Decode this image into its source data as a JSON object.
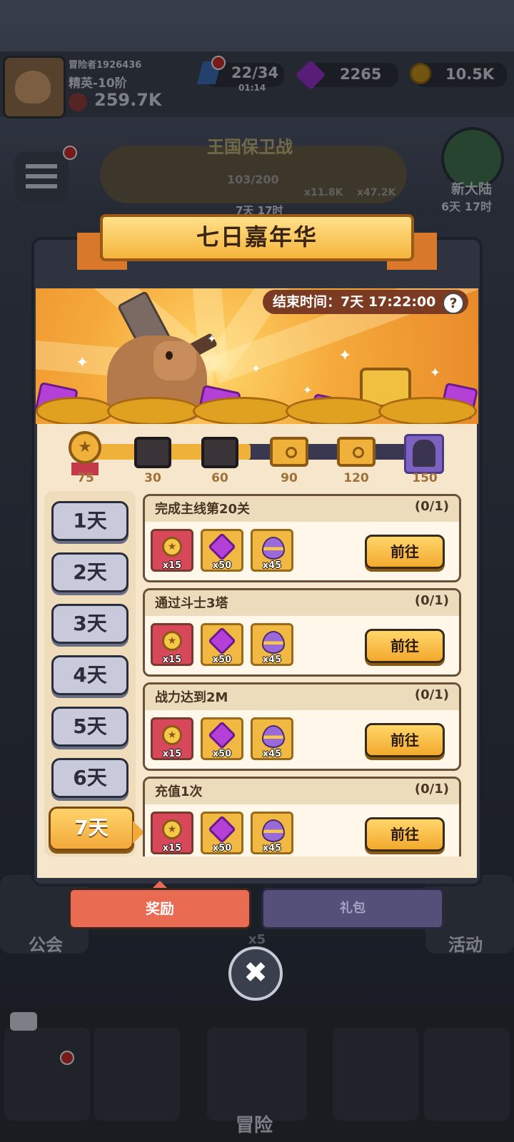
{
  "status_bar": {
    "player_name": "冒险者1926436",
    "rank": "精英-10阶",
    "power": "259.7K",
    "stamina": "22/34",
    "stamina_timer": "01:14",
    "gems": "2265",
    "coins": "10.5K"
  },
  "background_event": {
    "title": "王国保卫战",
    "progress": "103/200",
    "reward_a": "x11.8K",
    "reward_b": "x47.2K",
    "timer": "7天 17时"
  },
  "side_right": {
    "new_continent_label": "新大陆",
    "new_continent_timer": "6天 17时",
    "activity_label": "活动"
  },
  "side_left": {
    "guild_label": "公会"
  },
  "bottom_nav": {
    "adventure_label": "冒险",
    "multiplier": "x5"
  },
  "dialog": {
    "title": "七日嘉年华",
    "end_time": "结束时间：7天 17:22:00",
    "help_icon": "?",
    "milestones": [
      {
        "label": "75",
        "type": "medal-icon"
      },
      {
        "label": "30",
        "type": "dark-chest-icon"
      },
      {
        "label": "60",
        "type": "dark-chest-icon"
      },
      {
        "label": "90",
        "type": "gold-chest-icon"
      },
      {
        "label": "120",
        "type": "gold-chest-icon"
      },
      {
        "label": "150",
        "type": "hero-card-icon"
      }
    ],
    "milestone_progress_fraction": 0.49,
    "days": [
      "1天",
      "2天",
      "3天",
      "4天",
      "5天",
      "6天",
      "7天"
    ],
    "active_day": "7天",
    "tasks": [
      {
        "title": "完成主线第20关",
        "count": "(0/1)",
        "rewards": [
          "x15",
          "x50",
          "x45"
        ],
        "button": "前往"
      },
      {
        "title": "通过斗士3塔",
        "count": "(0/1)",
        "rewards": [
          "x15",
          "x50",
          "x45"
        ],
        "button": "前往"
      },
      {
        "title": "战力达到2M",
        "count": "(0/1)",
        "rewards": [
          "x15",
          "x50",
          "x45"
        ],
        "button": "前往"
      },
      {
        "title": "充值1次",
        "count": "(0/1)",
        "rewards": [
          "x15",
          "x50",
          "x45"
        ],
        "button": "前往"
      }
    ],
    "tabs": {
      "reward": "奖励",
      "gift": "礼包"
    },
    "close_icon": "✖"
  },
  "colors": {
    "accent_gold": "#f2a93a",
    "reward_tab": "#e86b52",
    "gift_tab": "#55507a",
    "cream_panel": "#f5e6cc"
  }
}
